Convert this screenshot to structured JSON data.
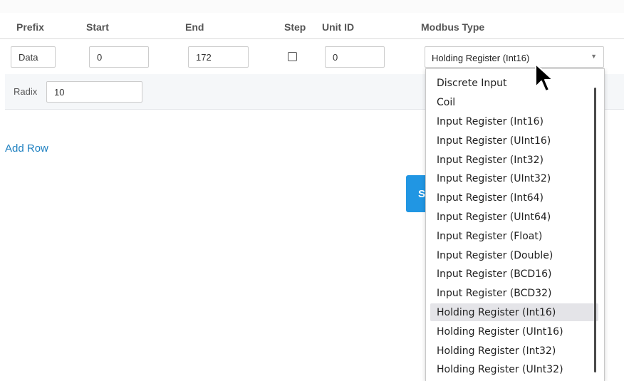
{
  "header": {
    "prefix": "Prefix",
    "start": "Start",
    "end": "End",
    "step": "Step",
    "unit_id": "Unit ID",
    "modbus_type": "Modbus Type"
  },
  "row": {
    "prefix_value": "Data",
    "start_value": "0",
    "end_value": "172",
    "step_checked": false,
    "unit_id_value": "0",
    "modbus_type_value": "Holding Register (Int16)",
    "radix_label": "Radix",
    "radix_value": "10"
  },
  "add_row_label": "Add Row",
  "save_button_label": "S",
  "dropdown": {
    "options": [
      "Discrete Input",
      "Coil",
      "Input Register (Int16)",
      "Input Register (UInt16)",
      "Input Register (Int32)",
      "Input Register (UInt32)",
      "Input Register (Int64)",
      "Input Register (UInt64)",
      "Input Register (Float)",
      "Input Register (Double)",
      "Input Register (BCD16)",
      "Input Register (BCD32)",
      "Holding Register (Int16)",
      "Holding Register (UInt16)",
      "Holding Register (Int32)",
      "Holding Register (UInt32)"
    ],
    "selected_index": 12
  },
  "colors": {
    "link": "#1c7fc0",
    "primary_button": "#2196e3",
    "selected_option_bg": "#e4e4e8"
  }
}
